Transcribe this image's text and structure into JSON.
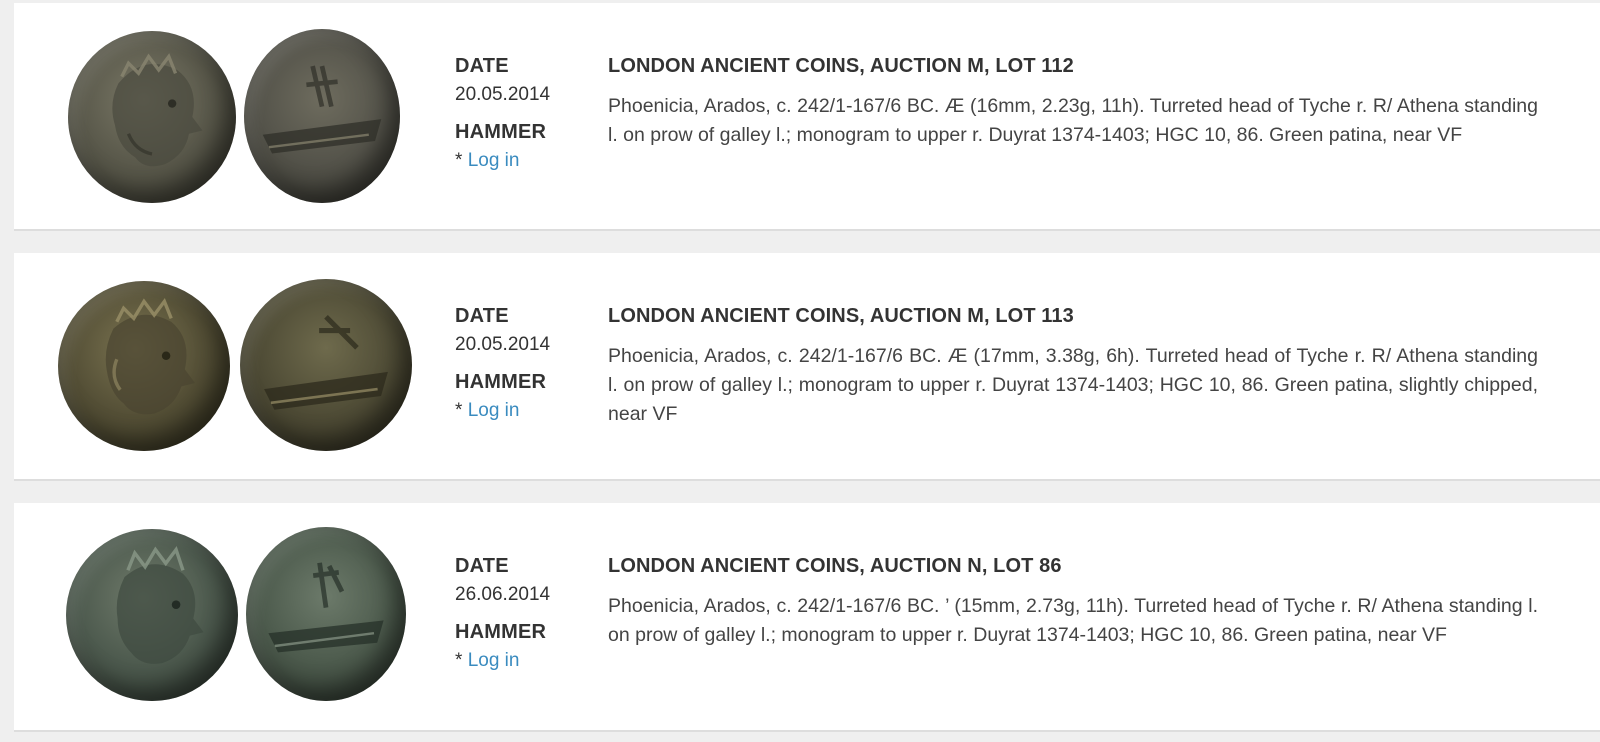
{
  "lots": [
    {
      "date_label": "DATE",
      "date": "20.05.2014",
      "hammer_label": "HAMMER",
      "hammer_prefix": "* ",
      "login_text": "Log in",
      "title": "LONDON ANCIENT COINS, AUCTION M, LOT 112",
      "description": "Phoenicia, Arados, c. 242/1-167/6 BC. Æ (16mm, 2.23g, 11h). Turreted head of Tyche r. R/ Athena standing l. on prow of galley l.; monogram to upper r. Duyrat 1374-1403; HGC 10, 86. Green patina, near VF",
      "coin_color": "#5b5a4c"
    },
    {
      "date_label": "DATE",
      "date": "20.05.2014",
      "hammer_label": "HAMMER",
      "hammer_prefix": "* ",
      "login_text": "Log in",
      "title": "LONDON ANCIENT COINS, AUCTION M, LOT 113",
      "description": "Phoenicia, Arados, c. 242/1-167/6 BC. Æ (17mm, 3.38g, 6h). Turreted head of Tyche r. R/ Athena standing l. on prow of galley l.; monogram to upper r. Duyrat 1374-1403; HGC 10, 86. Green patina, slightly chipped, near VF",
      "coin_color": "#4f4c36"
    },
    {
      "date_label": "DATE",
      "date": "26.06.2014",
      "hammer_label": "HAMMER",
      "hammer_prefix": "* ",
      "login_text": "Log in",
      "title": "LONDON ANCIENT COINS, AUCTION N, LOT 86",
      "description": "Phoenicia, Arados, c. 242/1-167/6 BC. ’ (15mm, 2.73g, 11h). Turreted head of Tyche r. R/ Athena standing l. on prow of galley l.; monogram to upper r. Duyrat 1374-1403; HGC 10, 86. Green patina, near VF",
      "coin_color": "#4d5a4e"
    }
  ],
  "colors": {
    "page_bg": "#efefef",
    "card_bg": "#ffffff",
    "link": "#3a8bbf",
    "text": "#333333"
  }
}
